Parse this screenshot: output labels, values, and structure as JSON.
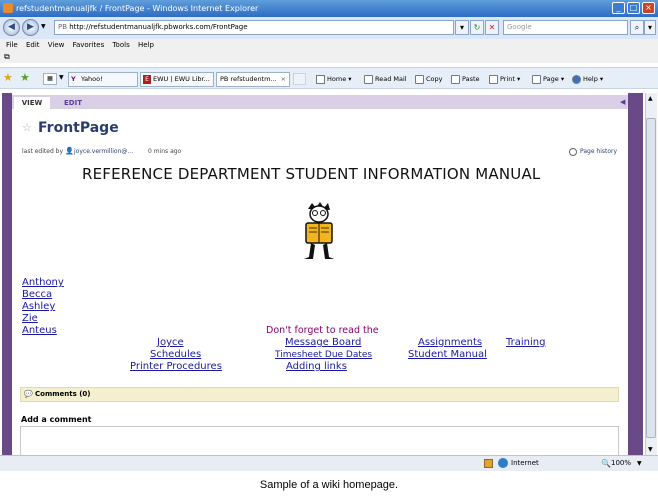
{
  "window": {
    "title": "refstudentmanualjfk / FrontPage - Windows Internet Explorer"
  },
  "address_bar": {
    "url": "http://refstudentmanualjfk.pbworks.com/FrontPage",
    "search_placeholder": "Google"
  },
  "menu": [
    "File",
    "Edit",
    "View",
    "Favorites",
    "Tools",
    "Help"
  ],
  "tabs": [
    {
      "label": "Yahoo!"
    },
    {
      "label": "EWU | EWU Libr..."
    },
    {
      "label": "PB refstudentm..."
    }
  ],
  "toolbar": {
    "home": "Home",
    "read_mail": "Read Mail",
    "copy": "Copy",
    "paste": "Paste",
    "print": "Print",
    "page": "Page",
    "help": "Help"
  },
  "wiki": {
    "view_tab": "VIEW",
    "edit_tab": "EDIT",
    "page_title": "FrontPage",
    "edited_label": "last edited by",
    "edited_by": "joyce.vermillion@...",
    "edited_ago": "0 mins ago",
    "page_history": "Page history",
    "heading": "REFERENCE DEPARTMENT STUDENT INFORMATION MANUAL",
    "people": [
      "Anthony",
      "Becca",
      "Ashley",
      "Zie",
      "Anteus"
    ],
    "notice": "Don't forget to read the",
    "links": {
      "joyce": "Joyce",
      "schedules": "Schedules",
      "printer": "Printer Procedures",
      "message_board": "Message Board",
      "timesheet": "Timesheet Due Dates",
      "adding_links": "Adding links",
      "assignments": "Assignments",
      "student_manual": "Student Manual",
      "training": "Training"
    },
    "comments_bar": "Comments (0)",
    "add_comment": "Add a comment"
  },
  "status": {
    "zone": "Internet",
    "zoom": "100%"
  },
  "caption": "Sample of a wiki homepage."
}
